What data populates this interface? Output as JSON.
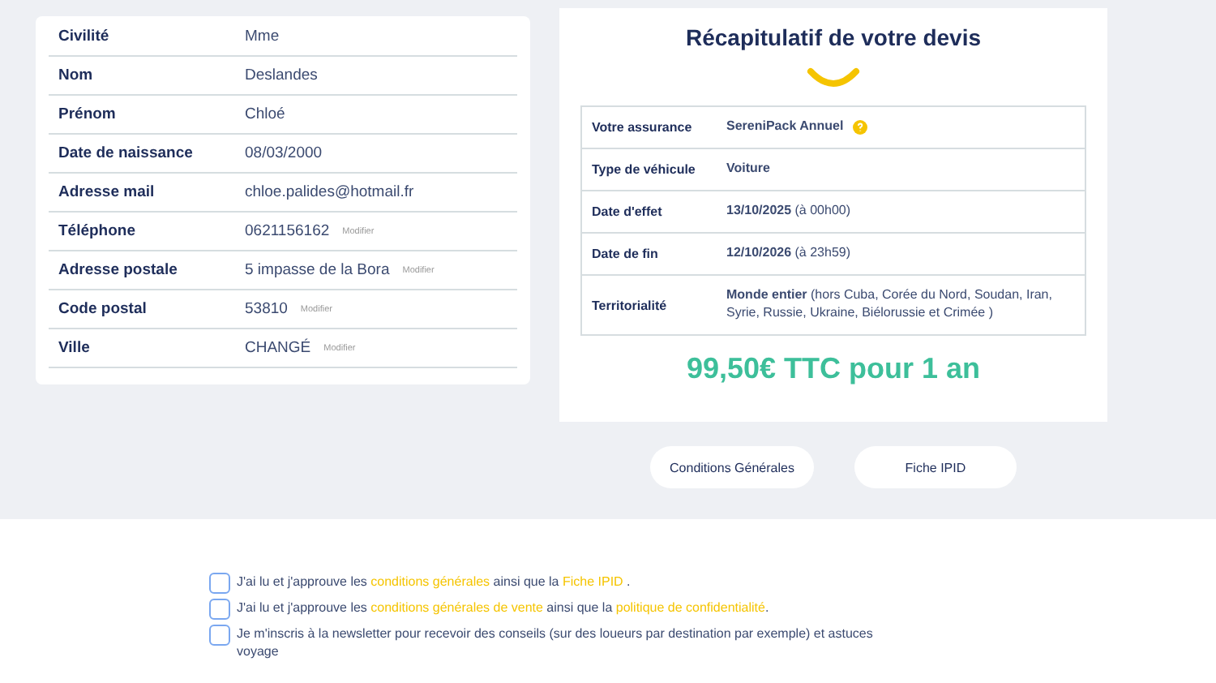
{
  "identity": {
    "rows": [
      {
        "label": "Civilité",
        "value": "Mme"
      },
      {
        "label": "Nom",
        "value": "Deslandes"
      },
      {
        "label": "Prénom",
        "value": "Chloé"
      },
      {
        "label": "Date de naissance",
        "value": "08/03/2000"
      },
      {
        "label": "Adresse mail",
        "value": "chloe.palides@hotmail.fr"
      },
      {
        "label": "Téléphone",
        "value": "0621156162",
        "action": "Modifier"
      },
      {
        "label": "Adresse postale",
        "value": "5 impasse de la Bora",
        "action": "Modifier"
      },
      {
        "label": "Code postal",
        "value": "53810",
        "action": "Modifier"
      },
      {
        "label": "Ville",
        "value": "CHANGÉ",
        "action": "Modifier"
      }
    ]
  },
  "summary": {
    "title": "Récapitulatif de votre devis",
    "rows": [
      {
        "label": "Votre assurance",
        "value": "**SereniPack Annuel**",
        "info": true
      },
      {
        "label": "Type de véhicule",
        "value": "**Voiture**",
        "info": false
      },
      {
        "label": "Date d'effet",
        "value": "**13/10/2025** (à 00h00)",
        "info": false
      },
      {
        "label": "Date de fin",
        "value": "**12/10/2026** (à 23h59)",
        "info": false
      },
      {
        "label": "Territorialité",
        "value": "**Monde entier** (hors Cuba, Corée du Nord, Soudan, Iran, Syrie, Russie, Ukraine, Biélorussie et Crimée )",
        "info": false
      }
    ],
    "price": "99,50€ TTC pour 1 an"
  },
  "buttons": [
    "Conditions Générales",
    "Fiche IPID"
  ],
  "consents": [
    {
      "checked": false,
      "parts": [
        {
          "kind": "text",
          "text": "J'ai lu et j'approuve les "
        },
        {
          "kind": "link",
          "text": "conditions générales"
        },
        {
          "kind": "text",
          "text": " ainsi que la "
        },
        {
          "kind": "link",
          "text": "Fiche IPID"
        },
        {
          "kind": "text",
          "text": " ."
        }
      ]
    },
    {
      "checked": false,
      "parts": [
        {
          "kind": "text",
          "text": "J'ai lu et j'approuve les "
        },
        {
          "kind": "link",
          "text": "conditions générales de vente"
        },
        {
          "kind": "text",
          "text": " ainsi que la "
        },
        {
          "kind": "link",
          "text": "politique de confidentialité"
        },
        {
          "kind": "text",
          "text": "."
        }
      ]
    },
    {
      "checked": false,
      "parts": [
        {
          "kind": "text",
          "text": "Je m'inscris à la newsletter pour recevoir des conseils (sur des loueurs par destination par exemple) et astuces voyage"
        }
      ]
    }
  ]
}
